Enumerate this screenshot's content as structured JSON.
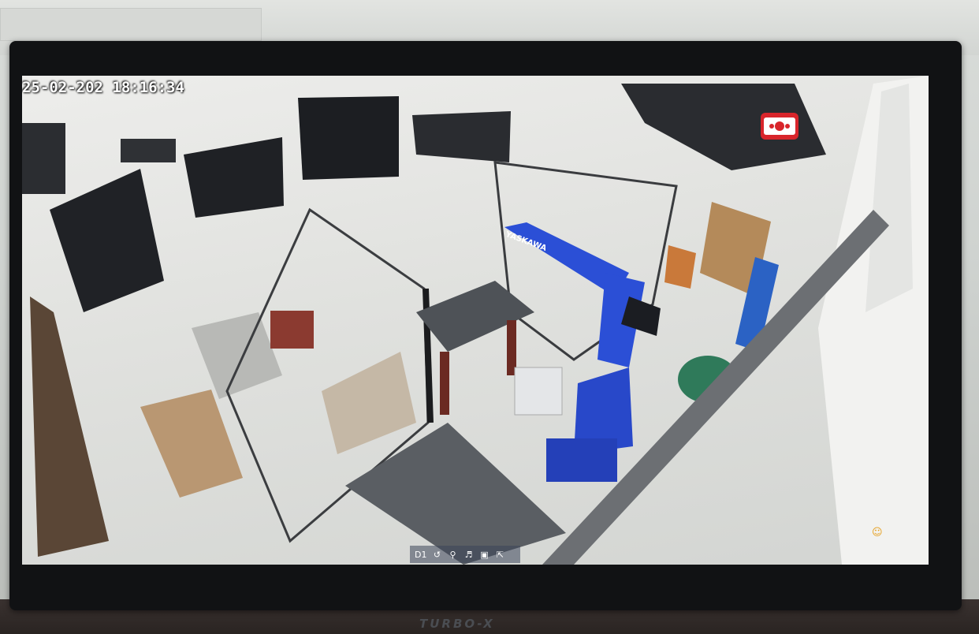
{
  "monitor": {
    "brand": "TURBO-X"
  },
  "camera_feed": {
    "timestamp": "25-02-202  18:16:34",
    "channel": "D1",
    "robot_label": "YASKAWA",
    "recording_icon": "record-icon"
  },
  "toolbar": {
    "icons": [
      "playback-icon",
      "zoom-icon",
      "audio-icon",
      "snapshot-icon",
      "fullscreen-icon"
    ]
  },
  "colors": {
    "robot": "#2b4fd6",
    "record": "#d8252b",
    "bezel": "#111214"
  }
}
